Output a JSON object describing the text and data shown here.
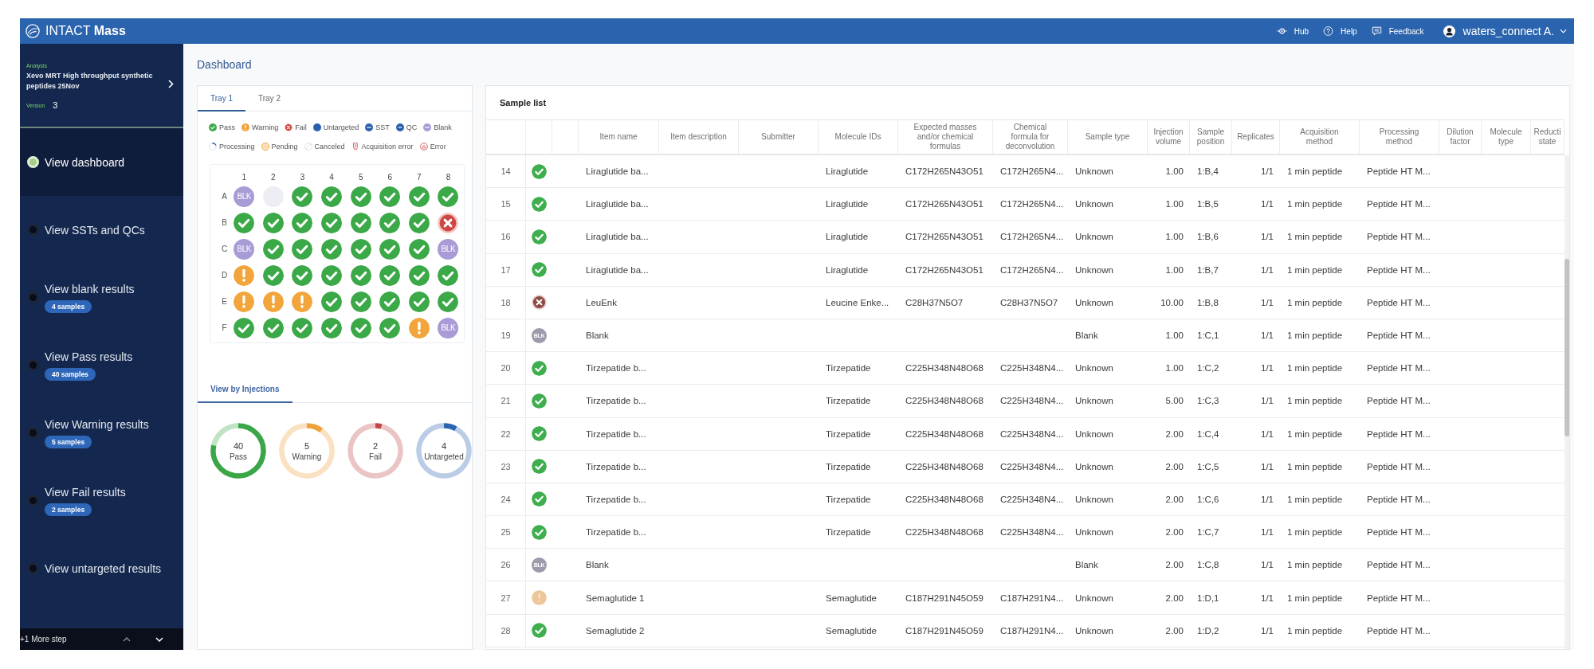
{
  "header": {
    "app_title": "INTACT **Mass**",
    "links": [
      {
        "label": "Hub",
        "kind": "hub"
      },
      {
        "label": "Help",
        "kind": "help"
      },
      {
        "label": "Feedback",
        "kind": "feedback"
      }
    ],
    "user": "waters_connect A."
  },
  "sidebar": {
    "analysis_label": "Analysis",
    "analysis_name": "Xevo MRT High throughput synthetic peptides 25Nov",
    "version_label": "Version",
    "version": "3",
    "steps": [
      {
        "label": "View dashboard",
        "selected": true
      },
      {
        "label": "View SSTs and QCs",
        "selected": false
      },
      {
        "label": "View blank results",
        "badge": "4 samples",
        "selected": false
      },
      {
        "label": "View Pass results",
        "badge": "40 samples",
        "selected": false
      },
      {
        "label": "View Warning results",
        "badge": "5 samples",
        "selected": false
      },
      {
        "label": "View Fail results",
        "badge": "2 samples",
        "selected": false
      },
      {
        "label": "View untargeted results",
        "selected": false
      }
    ],
    "more_steps": "+1 More step"
  },
  "page_title": "Dashboard",
  "tray_panel": {
    "tabs": [
      {
        "label": "Tray 1",
        "selected": true
      },
      {
        "label": "Tray 2",
        "selected": false
      }
    ],
    "legend": [
      [
        {
          "label": "Pass",
          "kind": "pass"
        },
        {
          "label": "Warning",
          "kind": "warning"
        },
        {
          "label": "Fail",
          "kind": "fail"
        },
        {
          "label": "Untargeted",
          "kind": "untargeted"
        },
        {
          "label": "SST",
          "kind": "sst"
        },
        {
          "label": "QC",
          "kind": "qc"
        },
        {
          "label": "Blank",
          "kind": "blank"
        }
      ],
      [
        {
          "label": "Processing",
          "kind": "processing"
        },
        {
          "label": "Pending",
          "kind": "pending"
        },
        {
          "label": "Canceled",
          "kind": "canceled"
        },
        {
          "label": "Acquisition error",
          "kind": "acquisition_error"
        },
        {
          "label": "Error",
          "kind": "error"
        }
      ]
    ],
    "plate": {
      "columns": [
        "1",
        "2",
        "3",
        "4",
        "5",
        "6",
        "7",
        "8"
      ],
      "rows": [
        {
          "label": "A",
          "wells": [
            {
              "kind": "blank",
              "label": "BLK"
            },
            {
              "kind": "empty"
            },
            {
              "kind": "pass"
            },
            {
              "kind": "pass"
            },
            {
              "kind": "pass"
            },
            {
              "kind": "pass"
            },
            {
              "kind": "pass"
            },
            {
              "kind": "pass"
            }
          ]
        },
        {
          "label": "B",
          "wells": [
            {
              "kind": "pass"
            },
            {
              "kind": "pass"
            },
            {
              "kind": "pass"
            },
            {
              "kind": "pass"
            },
            {
              "kind": "pass"
            },
            {
              "kind": "pass"
            },
            {
              "kind": "pass"
            },
            {
              "kind": "fail"
            }
          ]
        },
        {
          "label": "C",
          "wells": [
            {
              "kind": "blank",
              "label": "BLK"
            },
            {
              "kind": "pass"
            },
            {
              "kind": "pass"
            },
            {
              "kind": "pass"
            },
            {
              "kind": "pass"
            },
            {
              "kind": "pass"
            },
            {
              "kind": "pass"
            },
            {
              "kind": "blank",
              "label": "BLK"
            }
          ]
        },
        {
          "label": "D",
          "wells": [
            {
              "kind": "warning"
            },
            {
              "kind": "pass"
            },
            {
              "kind": "pass"
            },
            {
              "kind": "pass"
            },
            {
              "kind": "pass"
            },
            {
              "kind": "pass"
            },
            {
              "kind": "pass"
            },
            {
              "kind": "pass"
            }
          ]
        },
        {
          "label": "E",
          "wells": [
            {
              "kind": "warning"
            },
            {
              "kind": "warning"
            },
            {
              "kind": "warning"
            },
            {
              "kind": "pass"
            },
            {
              "kind": "pass"
            },
            {
              "kind": "pass"
            },
            {
              "kind": "pass"
            },
            {
              "kind": "pass"
            }
          ]
        },
        {
          "label": "F",
          "wells": [
            {
              "kind": "pass"
            },
            {
              "kind": "pass"
            },
            {
              "kind": "pass"
            },
            {
              "kind": "pass"
            },
            {
              "kind": "pass"
            },
            {
              "kind": "pass"
            },
            {
              "kind": "warning"
            },
            {
              "kind": "blank",
              "label": "BLK"
            }
          ]
        }
      ]
    },
    "view_tabs": [
      {
        "label": "View by Injections",
        "selected": true
      }
    ],
    "summary": [
      {
        "count": "40",
        "label": "Pass",
        "color": "#3aa648"
      },
      {
        "count": "5",
        "label": "Warning",
        "color": "#eea23c"
      },
      {
        "count": "2",
        "label": "Fail",
        "color": "#c2464a"
      },
      {
        "count": "4",
        "label": "Untargeted",
        "color": "#2b64b0"
      }
    ]
  },
  "sample_list": {
    "title": "Sample list",
    "columns": [
      "Item name",
      "Item description",
      "Submitter",
      "Molecule IDs",
      "Expected masses and/or chemical formulas",
      "Chemical formula for deconvolution",
      "Sample type",
      "Injection volume",
      "Sample position",
      "Replicates",
      "Acquisition method",
      "Processing method",
      "Dilution factor",
      "Molecule type",
      "Reducti state"
    ],
    "rows": [
      {
        "number": "14",
        "kind": "pass",
        "item_name": "Liraglutide ba...",
        "molecule_ids": "Liraglutide",
        "expected_masses": "C172H265N43O51",
        "chemical_formula": "C172H265N4...",
        "sample_type": "Unknown",
        "injection_volume": "1.00",
        "sample_position": "1:B,4",
        "replicates": "1/1",
        "acquisition_method": "1 min peptide",
        "processing_method": "Peptide HT M..."
      },
      {
        "number": "15",
        "kind": "pass",
        "item_name": "Liraglutide ba...",
        "molecule_ids": "Liraglutide",
        "expected_masses": "C172H265N43O51",
        "chemical_formula": "C172H265N4...",
        "sample_type": "Unknown",
        "injection_volume": "1.00",
        "sample_position": "1:B,5",
        "replicates": "1/1",
        "acquisition_method": "1 min peptide",
        "processing_method": "Peptide HT M..."
      },
      {
        "number": "16",
        "kind": "pass",
        "item_name": "Liraglutide ba...",
        "molecule_ids": "Liraglutide",
        "expected_masses": "C172H265N43O51",
        "chemical_formula": "C172H265N4...",
        "sample_type": "Unknown",
        "injection_volume": "1.00",
        "sample_position": "1:B,6",
        "replicates": "1/1",
        "acquisition_method": "1 min peptide",
        "processing_method": "Peptide HT M..."
      },
      {
        "number": "17",
        "kind": "pass",
        "item_name": "Liraglutide ba...",
        "molecule_ids": "Liraglutide",
        "expected_masses": "C172H265N43O51",
        "chemical_formula": "C172H265N4...",
        "sample_type": "Unknown",
        "injection_volume": "1.00",
        "sample_position": "1:B,7",
        "replicates": "1/1",
        "acquisition_method": "1 min peptide",
        "processing_method": "Peptide HT M..."
      },
      {
        "number": "18",
        "kind": "fail",
        "item_name": "LeuEnk",
        "molecule_ids": "Leucine Enke...",
        "expected_masses": "C28H37N5O7",
        "chemical_formula": "C28H37N5O7",
        "sample_type": "Unknown",
        "injection_volume": "10.00",
        "sample_position": "1:B,8",
        "replicates": "1/1",
        "acquisition_method": "1 min peptide",
        "processing_method": "Peptide HT M..."
      },
      {
        "number": "19",
        "kind": "blank",
        "marker_label": "BLK",
        "item_name": "Blank",
        "sample_type": "Blank",
        "injection_volume": "1.00",
        "sample_position": "1:C,1",
        "replicates": "1/1",
        "acquisition_method": "1 min peptide",
        "processing_method": "Peptide HT M..."
      },
      {
        "number": "20",
        "kind": "pass",
        "item_name": "Tirzepatide b...",
        "molecule_ids": "Tirzepatide",
        "expected_masses": "C225H348N48O68",
        "chemical_formula": "C225H348N4...",
        "sample_type": "Unknown",
        "injection_volume": "1.00",
        "sample_position": "1:C,2",
        "replicates": "1/1",
        "acquisition_method": "1 min peptide",
        "processing_method": "Peptide HT M..."
      },
      {
        "number": "21",
        "kind": "pass",
        "item_name": "Tirzepatide b...",
        "molecule_ids": "Tirzepatide",
        "expected_masses": "C225H348N48O68",
        "chemical_formula": "C225H348N4...",
        "sample_type": "Unknown",
        "injection_volume": "5.00",
        "sample_position": "1:C,3",
        "replicates": "1/1",
        "acquisition_method": "1 min peptide",
        "processing_method": "Peptide HT M..."
      },
      {
        "number": "22",
        "kind": "pass",
        "item_name": "Tirzepatide b...",
        "molecule_ids": "Tirzepatide",
        "expected_masses": "C225H348N48O68",
        "chemical_formula": "C225H348N4...",
        "sample_type": "Unknown",
        "injection_volume": "2.00",
        "sample_position": "1:C,4",
        "replicates": "1/1",
        "acquisition_method": "1 min peptide",
        "processing_method": "Peptide HT M..."
      },
      {
        "number": "23",
        "kind": "pass",
        "item_name": "Tirzepatide b...",
        "molecule_ids": "Tirzepatide",
        "expected_masses": "C225H348N48O68",
        "chemical_formula": "C225H348N4...",
        "sample_type": "Unknown",
        "injection_volume": "2.00",
        "sample_position": "1:C,5",
        "replicates": "1/1",
        "acquisition_method": "1 min peptide",
        "processing_method": "Peptide HT M..."
      },
      {
        "number": "24",
        "kind": "pass",
        "item_name": "Tirzepatide b...",
        "molecule_ids": "Tirzepatide",
        "expected_masses": "C225H348N48O68",
        "chemical_formula": "C225H348N4...",
        "sample_type": "Unknown",
        "injection_volume": "2.00",
        "sample_position": "1:C,6",
        "replicates": "1/1",
        "acquisition_method": "1 min peptide",
        "processing_method": "Peptide HT M..."
      },
      {
        "number": "25",
        "kind": "pass",
        "item_name": "Tirzepatide b...",
        "molecule_ids": "Tirzepatide",
        "expected_masses": "C225H348N48O68",
        "chemical_formula": "C225H348N4...",
        "sample_type": "Unknown",
        "injection_volume": "2.00",
        "sample_position": "1:C,7",
        "replicates": "1/1",
        "acquisition_method": "1 min peptide",
        "processing_method": "Peptide HT M..."
      },
      {
        "number": "26",
        "kind": "blank",
        "marker_label": "BLK",
        "item_name": "Blank",
        "sample_type": "Blank",
        "injection_volume": "2.00",
        "sample_position": "1:C,8",
        "replicates": "1/1",
        "acquisition_method": "1 min peptide",
        "processing_method": "Peptide HT M..."
      },
      {
        "number": "27",
        "kind": "warning",
        "item_name": "Semaglutide 1",
        "molecule_ids": "Semaglutide",
        "expected_masses": "C187H291N45O59",
        "chemical_formula": "C187H291N4...",
        "sample_type": "Unknown",
        "injection_volume": "2.00",
        "sample_position": "1:D,1",
        "replicates": "1/1",
        "acquisition_method": "1 min peptide",
        "processing_method": "Peptide HT M..."
      },
      {
        "number": "28",
        "kind": "pass",
        "item_name": "Semaglutide 2",
        "molecule_ids": "Semaglutide",
        "expected_masses": "C187H291N45O59",
        "chemical_formula": "C187H291N4...",
        "sample_type": "Unknown",
        "injection_volume": "2.00",
        "sample_position": "1:D,2",
        "replicates": "1/1",
        "acquisition_method": "1 min peptide",
        "processing_method": "Peptide HT M..."
      }
    ]
  }
}
